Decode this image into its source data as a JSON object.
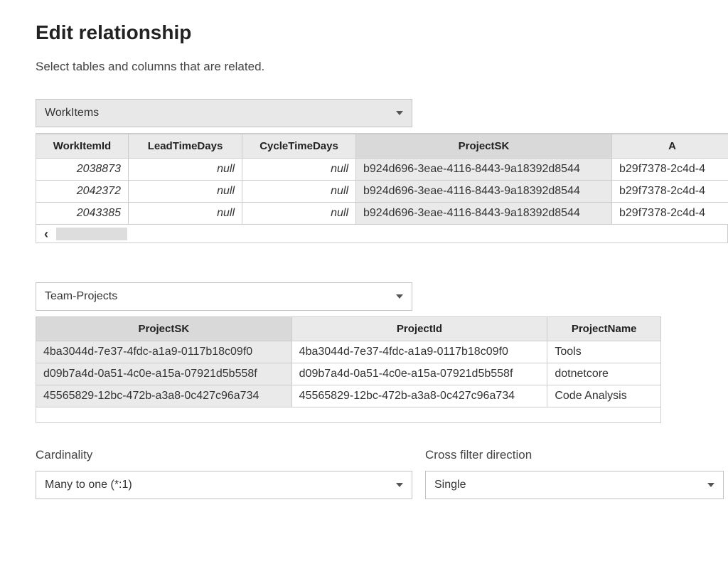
{
  "title": "Edit relationship",
  "subtitle": "Select tables and columns that are related.",
  "table1": {
    "selected": "WorkItems",
    "columns": [
      "WorkItemId",
      "LeadTimeDays",
      "CycleTimeDays",
      "ProjectSK",
      "A"
    ],
    "rows": [
      {
        "WorkItemId": "2038873",
        "LeadTimeDays": "null",
        "CycleTimeDays": "null",
        "ProjectSK": "b924d696-3eae-4116-8443-9a18392d8544",
        "A": "b29f7378-2c4d-4"
      },
      {
        "WorkItemId": "2042372",
        "LeadTimeDays": "null",
        "CycleTimeDays": "null",
        "ProjectSK": "b924d696-3eae-4116-8443-9a18392d8544",
        "A": "b29f7378-2c4d-4"
      },
      {
        "WorkItemId": "2043385",
        "LeadTimeDays": "null",
        "CycleTimeDays": "null",
        "ProjectSK": "b924d696-3eae-4116-8443-9a18392d8544",
        "A": "b29f7378-2c4d-4"
      }
    ]
  },
  "table2": {
    "selected": "Team-Projects",
    "columns": [
      "ProjectSK",
      "ProjectId",
      "ProjectName"
    ],
    "rows": [
      {
        "ProjectSK": "4ba3044d-7e37-4fdc-a1a9-0117b18c09f0",
        "ProjectId": "4ba3044d-7e37-4fdc-a1a9-0117b18c09f0",
        "ProjectName": "Tools"
      },
      {
        "ProjectSK": "d09b7a4d-0a51-4c0e-a15a-07921d5b558f",
        "ProjectId": "d09b7a4d-0a51-4c0e-a15a-07921d5b558f",
        "ProjectName": "dotnetcore"
      },
      {
        "ProjectSK": "45565829-12bc-472b-a3a8-0c427c96a734",
        "ProjectId": "45565829-12bc-472b-a3a8-0c427c96a734",
        "ProjectName": "Code Analysis"
      }
    ]
  },
  "cardinality": {
    "label": "Cardinality",
    "value": "Many to one (*:1)"
  },
  "crossfilter": {
    "label": "Cross filter direction",
    "value": "Single"
  }
}
